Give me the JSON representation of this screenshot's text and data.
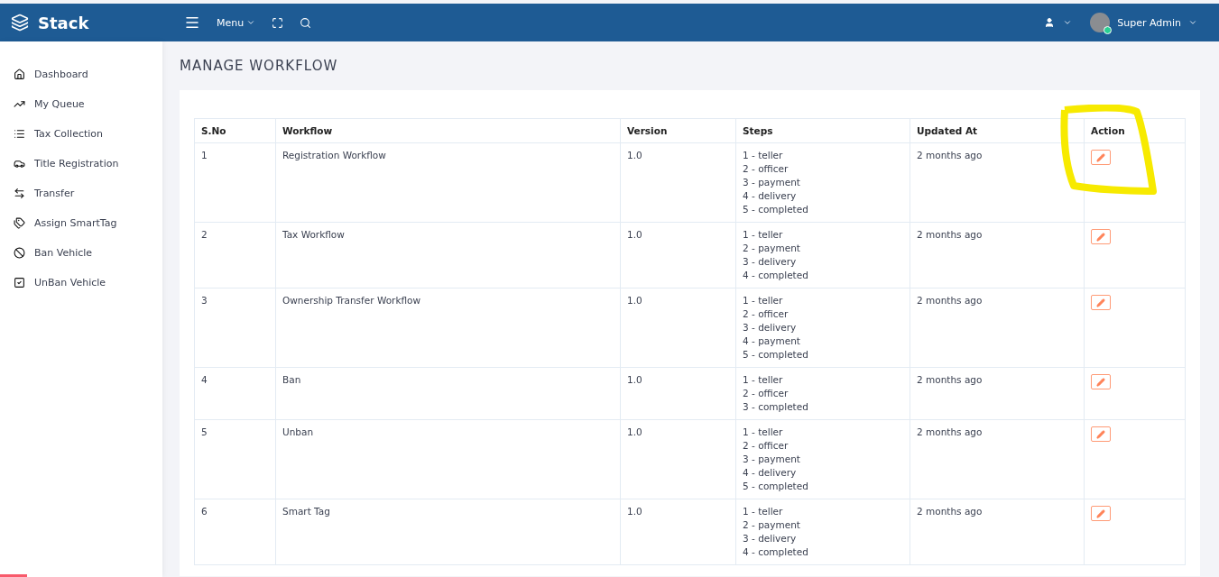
{
  "brand": {
    "name": "Stack"
  },
  "topbar": {
    "menu_label": "Menu",
    "user_name": "Super Admin",
    "online": true
  },
  "sidebar": {
    "items": [
      {
        "label": "Dashboard"
      },
      {
        "label": "My Queue"
      },
      {
        "label": "Tax Collection"
      },
      {
        "label": "Title Registration"
      },
      {
        "label": "Transfer"
      },
      {
        "label": "Assign SmartTag"
      },
      {
        "label": "Ban Vehicle"
      },
      {
        "label": "UnBan Vehicle"
      }
    ]
  },
  "page": {
    "title": "MANAGE WORKFLOW"
  },
  "table": {
    "columns": [
      "S.No",
      "Workflow",
      "Version",
      "Steps",
      "Updated At",
      "Action"
    ],
    "rows": [
      {
        "sno": "1",
        "workflow": "Registration Workflow",
        "version": "1.0",
        "steps": [
          "1 - teller",
          "2 - officer",
          "3 - payment",
          "4 - delivery",
          "5 - completed"
        ],
        "updated": "2 months ago"
      },
      {
        "sno": "2",
        "workflow": "Tax Workflow",
        "version": "1.0",
        "steps": [
          "1 - teller",
          "2 - payment",
          "3 - delivery",
          "4 - completed"
        ],
        "updated": "2 months ago"
      },
      {
        "sno": "3",
        "workflow": "Ownership Transfer Workflow",
        "version": "1.0",
        "steps": [
          "1 - teller",
          "2 - officer",
          "3 - delivery",
          "4 - payment",
          "5 - completed"
        ],
        "updated": "2 months ago"
      },
      {
        "sno": "4",
        "workflow": "Ban",
        "version": "1.0",
        "steps": [
          "1 - teller",
          "2 - officer",
          "3 - completed"
        ],
        "updated": "2 months ago"
      },
      {
        "sno": "5",
        "workflow": "Unban",
        "version": "1.0",
        "steps": [
          "1 - teller",
          "2 - officer",
          "3 - payment",
          "4 - delivery",
          "5 - completed"
        ],
        "updated": "2 months ago"
      },
      {
        "sno": "6",
        "workflow": "Smart Tag",
        "version": "1.0",
        "steps": [
          "1 - teller",
          "2 - payment",
          "3 - delivery",
          "4 - completed"
        ],
        "updated": "2 months ago"
      }
    ]
  }
}
